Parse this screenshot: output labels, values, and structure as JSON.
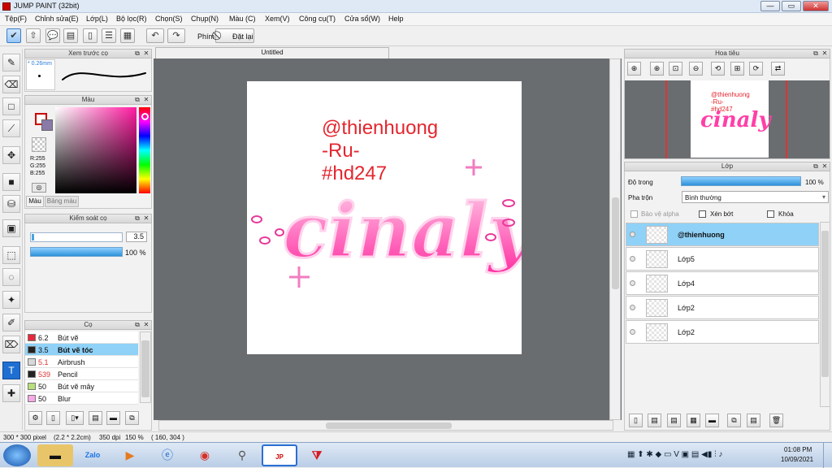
{
  "window": {
    "title": "JUMP PAINT (32bit)",
    "min": "—",
    "restore": "▭",
    "close": "✕"
  },
  "menu": [
    "Tệp(F)",
    "Chỉnh sửa(E)",
    "Lớp(L)",
    "Bộ lọc(R)",
    "Chọn(S)",
    "Chụp(N)",
    "Màu (C)",
    "Xem(V)",
    "Công cụ(T)",
    "Cửa sổ(W)",
    "Help"
  ],
  "toolbar": {
    "key_label": "Phím",
    "reset_label": "Đặt lại"
  },
  "panels": {
    "preview": {
      "title": "Xem trước cọ",
      "size": "* 0.26mm"
    },
    "color": {
      "title": "Màu",
      "r": "R:255",
      "g": "G:255",
      "b": "B:255",
      "tab_color": "Màu",
      "tab_palette": "Bảng màu"
    },
    "brush_control": {
      "title": "Kiểm soát cọ",
      "size_value": "3.5",
      "opacity_value": "100 %"
    },
    "brush": {
      "title": "Cọ",
      "items": [
        {
          "size": "6.2",
          "name": "Bút vẽ",
          "color": "#e8283a",
          "size_color": "#111"
        },
        {
          "size": "3.5",
          "name": "Bút vẽ tóc",
          "color": "#222222",
          "size_color": "#111"
        },
        {
          "size": "5.1",
          "name": "Airbrush",
          "color": "#d8d8d8",
          "size_color": "#d33"
        },
        {
          "size": "539",
          "name": "Pencil",
          "color": "#222222",
          "size_color": "#d33"
        },
        {
          "size": "50",
          "name": "Bút vẽ mây",
          "color": "#b8e07a",
          "size_color": "#111"
        },
        {
          "size": "50",
          "name": "Blur",
          "color": "#f7a8e6",
          "size_color": "#111"
        }
      ]
    },
    "navigator": {
      "title": "Hoa tiêu"
    },
    "layers": {
      "title": "Lớp",
      "opacity_label": "Độ trong",
      "opacity_value": "100 %",
      "blend_label": "Pha trộn",
      "blend_value": "Bình thường",
      "protect_alpha": "Bảo vệ alpha",
      "clipping": "Xén bớt",
      "lock": "Khóa",
      "items": [
        "@thienhuong",
        "Lớp5",
        "Lớp4",
        "Lớp2",
        "Lớp2"
      ]
    }
  },
  "document": {
    "tab": "Untitled",
    "text_line1": "@thienhuong",
    "text_line2": "-Ru-",
    "text_line3": "#hd247",
    "art_word": "cinaly",
    "thumb_line1": "@thienhuong",
    "thumb_line2": "-Ru-",
    "thumb_line3": "#hd247"
  },
  "status": {
    "size": "300 * 300 pixel",
    "cm": "(2.2 * 2.2cm)",
    "dpi": "350 dpi",
    "zoom": "150 %",
    "coords": "( 160, 304 )"
  },
  "taskbar": {
    "time": "01:08 PM",
    "date": "10/09/2021"
  }
}
